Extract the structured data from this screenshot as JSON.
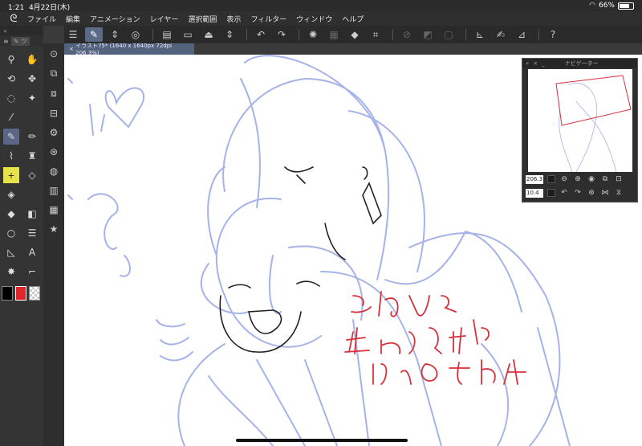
{
  "status": {
    "time": "1:21",
    "date": "4月22日(木)",
    "battery": "66%"
  },
  "menu": [
    "ファイル",
    "編集",
    "アニメーション",
    "レイヤー",
    "選択範囲",
    "表示",
    "フィルター",
    "ウィンドウ",
    "ヘルプ"
  ],
  "tab": {
    "label": "イラスト75* (1640 x 1640px 72dpi 206.3%)"
  },
  "tool_panel": {
    "subtool": "ツ"
  },
  "colors": {
    "main": "#000000",
    "sub": "#e0262d",
    "canvas_line": "#a5b3e8",
    "text_red": "#d8303a"
  },
  "navigator": {
    "title": "ナビゲーター",
    "zoom": "206.3",
    "angle": "10.4"
  },
  "canvas_text": [
    "これは",
    "甘えんぼうジェリ4",
    "17さいのすがた"
  ]
}
